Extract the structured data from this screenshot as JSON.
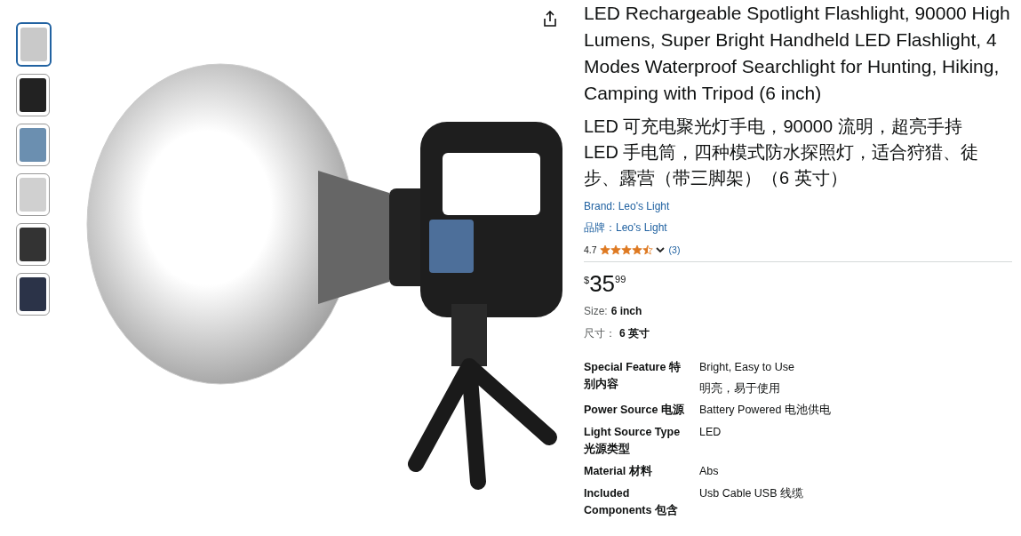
{
  "thumbnails": [
    {
      "selected": true
    },
    {
      "selected": false
    },
    {
      "selected": false
    },
    {
      "selected": false
    },
    {
      "selected": false
    },
    {
      "selected": false
    }
  ],
  "title": "LED Rechargeable Spotlight Flashlight, 90000 High Lumens, Super Bright Handheld LED Flashlight, 4 Modes Waterproof Searchlight for Hunting, Hiking, Camping with Tripod (6 inch)",
  "title_translation": "LED 可充电聚光灯手电，90000 流明，超亮手持 LED 手电筒，四种模式防水探照灯，适合狩猎、徒步、露营（带三脚架）（6 英寸）",
  "brand": "Brand: Leo's Light",
  "brand_translation": "品牌：Leo's Light",
  "rating": {
    "value": "4.7",
    "stars": 4.5,
    "count": "(3)"
  },
  "price": {
    "currency": "$",
    "whole": "35",
    "fraction": "99"
  },
  "size": {
    "label": "Size:",
    "value": "6 inch"
  },
  "size_translation": {
    "label": "尺寸：",
    "value": "6 英寸"
  },
  "specs": [
    {
      "label": "Special Feature  特别内容",
      "values": [
        "Bright, Easy to Use",
        "明亮，易于使用"
      ]
    },
    {
      "label": "Power Source  电源",
      "values": [
        "Battery Powered  电池供电"
      ]
    },
    {
      "label": "Light Source Type  光源类型",
      "values": [
        "LED"
      ]
    },
    {
      "label": "Material  材料",
      "values": [
        "Abs"
      ]
    },
    {
      "label": "Included Components  包含",
      "values": [
        "Usb Cable  USB 线缆"
      ]
    }
  ]
}
